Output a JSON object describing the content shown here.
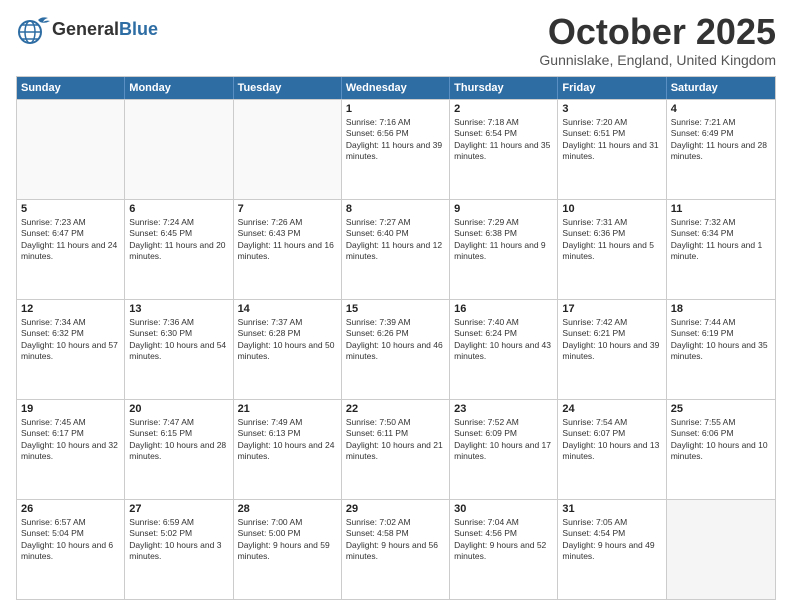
{
  "header": {
    "logo_general": "General",
    "logo_blue": "Blue",
    "month": "October 2025",
    "location": "Gunnislake, England, United Kingdom"
  },
  "days_of_week": [
    "Sunday",
    "Monday",
    "Tuesday",
    "Wednesday",
    "Thursday",
    "Friday",
    "Saturday"
  ],
  "weeks": [
    [
      {
        "day": "",
        "sunrise": "",
        "sunset": "",
        "daylight": ""
      },
      {
        "day": "",
        "sunrise": "",
        "sunset": "",
        "daylight": ""
      },
      {
        "day": "",
        "sunrise": "",
        "sunset": "",
        "daylight": ""
      },
      {
        "day": "1",
        "sunrise": "Sunrise: 7:16 AM",
        "sunset": "Sunset: 6:56 PM",
        "daylight": "Daylight: 11 hours and 39 minutes."
      },
      {
        "day": "2",
        "sunrise": "Sunrise: 7:18 AM",
        "sunset": "Sunset: 6:54 PM",
        "daylight": "Daylight: 11 hours and 35 minutes."
      },
      {
        "day": "3",
        "sunrise": "Sunrise: 7:20 AM",
        "sunset": "Sunset: 6:51 PM",
        "daylight": "Daylight: 11 hours and 31 minutes."
      },
      {
        "day": "4",
        "sunrise": "Sunrise: 7:21 AM",
        "sunset": "Sunset: 6:49 PM",
        "daylight": "Daylight: 11 hours and 28 minutes."
      }
    ],
    [
      {
        "day": "5",
        "sunrise": "Sunrise: 7:23 AM",
        "sunset": "Sunset: 6:47 PM",
        "daylight": "Daylight: 11 hours and 24 minutes."
      },
      {
        "day": "6",
        "sunrise": "Sunrise: 7:24 AM",
        "sunset": "Sunset: 6:45 PM",
        "daylight": "Daylight: 11 hours and 20 minutes."
      },
      {
        "day": "7",
        "sunrise": "Sunrise: 7:26 AM",
        "sunset": "Sunset: 6:43 PM",
        "daylight": "Daylight: 11 hours and 16 minutes."
      },
      {
        "day": "8",
        "sunrise": "Sunrise: 7:27 AM",
        "sunset": "Sunset: 6:40 PM",
        "daylight": "Daylight: 11 hours and 12 minutes."
      },
      {
        "day": "9",
        "sunrise": "Sunrise: 7:29 AM",
        "sunset": "Sunset: 6:38 PM",
        "daylight": "Daylight: 11 hours and 9 minutes."
      },
      {
        "day": "10",
        "sunrise": "Sunrise: 7:31 AM",
        "sunset": "Sunset: 6:36 PM",
        "daylight": "Daylight: 11 hours and 5 minutes."
      },
      {
        "day": "11",
        "sunrise": "Sunrise: 7:32 AM",
        "sunset": "Sunset: 6:34 PM",
        "daylight": "Daylight: 11 hours and 1 minute."
      }
    ],
    [
      {
        "day": "12",
        "sunrise": "Sunrise: 7:34 AM",
        "sunset": "Sunset: 6:32 PM",
        "daylight": "Daylight: 10 hours and 57 minutes."
      },
      {
        "day": "13",
        "sunrise": "Sunrise: 7:36 AM",
        "sunset": "Sunset: 6:30 PM",
        "daylight": "Daylight: 10 hours and 54 minutes."
      },
      {
        "day": "14",
        "sunrise": "Sunrise: 7:37 AM",
        "sunset": "Sunset: 6:28 PM",
        "daylight": "Daylight: 10 hours and 50 minutes."
      },
      {
        "day": "15",
        "sunrise": "Sunrise: 7:39 AM",
        "sunset": "Sunset: 6:26 PM",
        "daylight": "Daylight: 10 hours and 46 minutes."
      },
      {
        "day": "16",
        "sunrise": "Sunrise: 7:40 AM",
        "sunset": "Sunset: 6:24 PM",
        "daylight": "Daylight: 10 hours and 43 minutes."
      },
      {
        "day": "17",
        "sunrise": "Sunrise: 7:42 AM",
        "sunset": "Sunset: 6:21 PM",
        "daylight": "Daylight: 10 hours and 39 minutes."
      },
      {
        "day": "18",
        "sunrise": "Sunrise: 7:44 AM",
        "sunset": "Sunset: 6:19 PM",
        "daylight": "Daylight: 10 hours and 35 minutes."
      }
    ],
    [
      {
        "day": "19",
        "sunrise": "Sunrise: 7:45 AM",
        "sunset": "Sunset: 6:17 PM",
        "daylight": "Daylight: 10 hours and 32 minutes."
      },
      {
        "day": "20",
        "sunrise": "Sunrise: 7:47 AM",
        "sunset": "Sunset: 6:15 PM",
        "daylight": "Daylight: 10 hours and 28 minutes."
      },
      {
        "day": "21",
        "sunrise": "Sunrise: 7:49 AM",
        "sunset": "Sunset: 6:13 PM",
        "daylight": "Daylight: 10 hours and 24 minutes."
      },
      {
        "day": "22",
        "sunrise": "Sunrise: 7:50 AM",
        "sunset": "Sunset: 6:11 PM",
        "daylight": "Daylight: 10 hours and 21 minutes."
      },
      {
        "day": "23",
        "sunrise": "Sunrise: 7:52 AM",
        "sunset": "Sunset: 6:09 PM",
        "daylight": "Daylight: 10 hours and 17 minutes."
      },
      {
        "day": "24",
        "sunrise": "Sunrise: 7:54 AM",
        "sunset": "Sunset: 6:07 PM",
        "daylight": "Daylight: 10 hours and 13 minutes."
      },
      {
        "day": "25",
        "sunrise": "Sunrise: 7:55 AM",
        "sunset": "Sunset: 6:06 PM",
        "daylight": "Daylight: 10 hours and 10 minutes."
      }
    ],
    [
      {
        "day": "26",
        "sunrise": "Sunrise: 6:57 AM",
        "sunset": "Sunset: 5:04 PM",
        "daylight": "Daylight: 10 hours and 6 minutes."
      },
      {
        "day": "27",
        "sunrise": "Sunrise: 6:59 AM",
        "sunset": "Sunset: 5:02 PM",
        "daylight": "Daylight: 10 hours and 3 minutes."
      },
      {
        "day": "28",
        "sunrise": "Sunrise: 7:00 AM",
        "sunset": "Sunset: 5:00 PM",
        "daylight": "Daylight: 9 hours and 59 minutes."
      },
      {
        "day": "29",
        "sunrise": "Sunrise: 7:02 AM",
        "sunset": "Sunset: 4:58 PM",
        "daylight": "Daylight: 9 hours and 56 minutes."
      },
      {
        "day": "30",
        "sunrise": "Sunrise: 7:04 AM",
        "sunset": "Sunset: 4:56 PM",
        "daylight": "Daylight: 9 hours and 52 minutes."
      },
      {
        "day": "31",
        "sunrise": "Sunrise: 7:05 AM",
        "sunset": "Sunset: 4:54 PM",
        "daylight": "Daylight: 9 hours and 49 minutes."
      },
      {
        "day": "",
        "sunrise": "",
        "sunset": "",
        "daylight": ""
      }
    ]
  ]
}
